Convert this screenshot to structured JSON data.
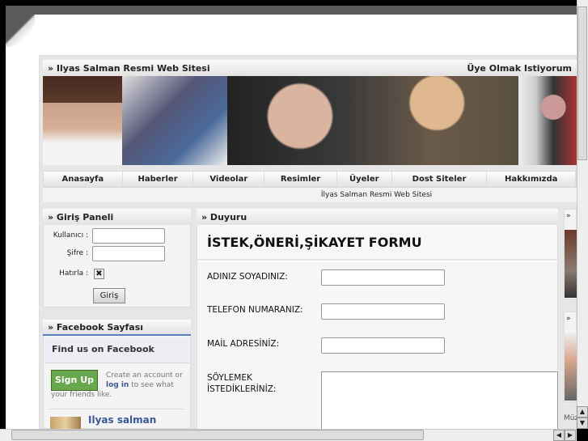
{
  "header": {
    "title": "» Ilyas Salman Resmi Web Sitesi",
    "register_link": "Üye Olmak Istiyorum"
  },
  "nav": [
    "Anasayfa",
    "Haberler",
    "Videolar",
    "Resimler",
    "Üyeler",
    "Dost Siteler",
    "Hakkımızda"
  ],
  "subtitle": "İlyas Salman Resmi Web Sitesi",
  "login": {
    "title": "» Giriş Paneli",
    "user_label": "Kullanıcı :",
    "pass_label": "Şifre :",
    "remember_label": "Hatırla :",
    "remember_checked": true,
    "submit": "Giriş"
  },
  "facebook": {
    "title": "» Facebook Sayfası",
    "heading": "Find us on Facebook",
    "signup": "Sign Up",
    "text1": "Create an account or",
    "login_link": "log in",
    "text2": " to see what your friends like.",
    "page_name": "Ilyas salman"
  },
  "duyuru": {
    "title": "» Duyuru",
    "form_title": "İSTEK,ÖNERİ,ŞİKAYET FORMU",
    "fields": [
      "ADINIZ SOYADINIZ:",
      "TELEFON NUMARANIZ:",
      "MAİL ADRESİNİZ:"
    ],
    "message_label_1": "SÖYLEMEK",
    "message_label_2": "İSTEDİKLERİNİZ:"
  },
  "right": {
    "h1": "»",
    "h2": "»",
    "cut_text": "Müz"
  }
}
